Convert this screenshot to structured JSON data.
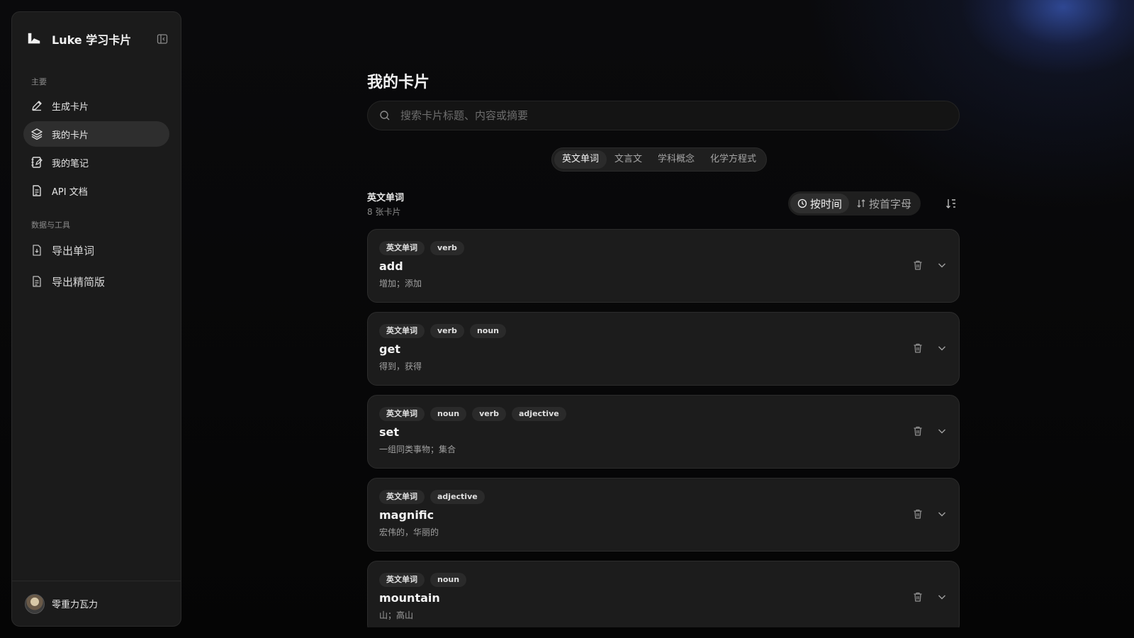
{
  "app": {
    "title": "Luke 学习卡片"
  },
  "sidebar": {
    "section_main": "主要",
    "items": [
      {
        "label": "生成卡片",
        "icon": "pencil-icon"
      },
      {
        "label": "我的卡片",
        "icon": "layers-icon",
        "active": true
      },
      {
        "label": "我的笔记",
        "icon": "notebook-icon"
      },
      {
        "label": "API 文档",
        "icon": "document-icon"
      }
    ],
    "section_tools": "数据与工具",
    "tools": [
      {
        "label": "导出单词",
        "icon": "file-download-icon"
      },
      {
        "label": "导出精简版",
        "icon": "file-text-icon"
      }
    ],
    "user": {
      "name": "零重力瓦力"
    }
  },
  "main": {
    "page_title": "我的卡片",
    "search": {
      "placeholder": "搜索卡片标题、内容或摘要",
      "value": ""
    },
    "tabs": [
      {
        "label": "英文单词",
        "active": true
      },
      {
        "label": "文言文"
      },
      {
        "label": "学科概念"
      },
      {
        "label": "化学方程式"
      }
    ],
    "list": {
      "title": "英文单词",
      "count": "8 张卡片",
      "sort_time": "按时间",
      "sort_alpha": "按首字母"
    },
    "cards": [
      {
        "tags": [
          "英文单词",
          "verb"
        ],
        "word": "add",
        "meaning": "增加；添加"
      },
      {
        "tags": [
          "英文单词",
          "verb",
          "noun"
        ],
        "word": "get",
        "meaning": "得到，获得"
      },
      {
        "tags": [
          "英文单词",
          "noun",
          "verb",
          "adjective"
        ],
        "word": "set",
        "meaning": "一组同类事物；集合"
      },
      {
        "tags": [
          "英文单词",
          "adjective"
        ],
        "word": "magnific",
        "meaning": "宏伟的，华丽的"
      },
      {
        "tags": [
          "英文单词",
          "noun"
        ],
        "word": "mountain",
        "meaning": "山；高山"
      }
    ]
  },
  "colors": {
    "background": "#070707",
    "panel": "#1b1b1b",
    "card": "#1c1c1c",
    "accent_glow": "#466ee6"
  }
}
